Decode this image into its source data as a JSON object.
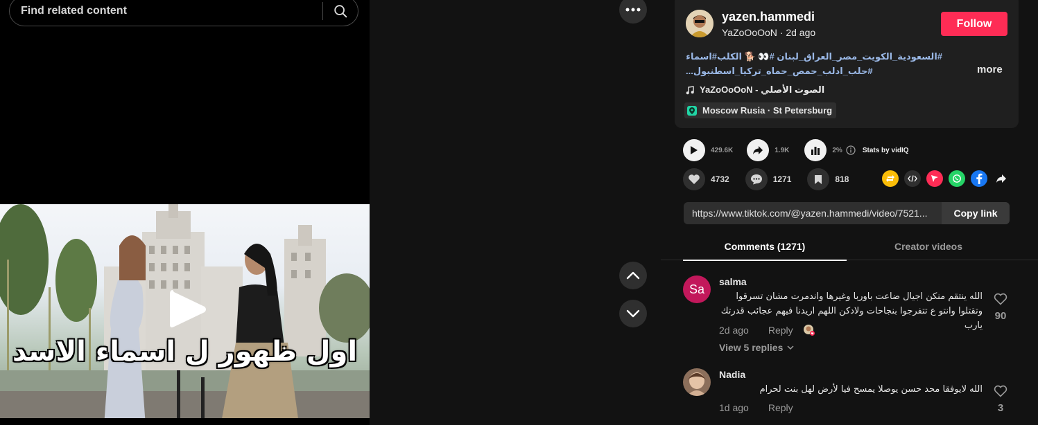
{
  "search": {
    "placeholder": "Find related content"
  },
  "video": {
    "overlay_text": "اول ظهور ل اسماء الاسد"
  },
  "post": {
    "username": "yazen.hammedi",
    "nickname": "YaZoOoOoN",
    "separator": " · ",
    "posted": "2d ago",
    "follow_label": "Follow",
    "desc_line1": "#السعودية_الكويت_مصر_العراق_لبنان #👀 🐕 الكلب#اسماء#",
    "desc_line2": "#حلب_ادلب_حمص_حماه_تركيا_اسطنبول...",
    "more_label": "more",
    "music": "الصوت الأصلي - YaZoOoOoN",
    "location": "Moscow Rusia · St Petersburg"
  },
  "stats": {
    "plays": "429.6K",
    "shares": "1.9K",
    "engagement": "2%",
    "stats_by": "Stats by vidIQ"
  },
  "actions": {
    "likes": "4732",
    "comments": "1271",
    "saves": "818"
  },
  "link": {
    "url": "https://www.tiktok.com/@yazen.hammedi/video/7521...",
    "copy_label": "Copy link"
  },
  "tabs": {
    "comments": "Comments (1271)",
    "creator": "Creator videos"
  },
  "comments": [
    {
      "name": "salma",
      "initials": "Sa",
      "text": "الله ينتقم منكن اجيال ضاعت باوربا وغيرها واندمرت مشان تسرقوا وتقتلوا وانتو ع تتفرجوا بنجاحات ولادكن اللهم اريدنا فيهم عجائب قدرتك يارب",
      "time": "2d ago",
      "reply": "Reply",
      "likes": "90",
      "view_replies": "View 5 replies"
    },
    {
      "name": "Nadia",
      "text": "الله لايوفقا محد حسن يوصلا يمسح فيا لأرض لهل بنت لحرام",
      "time": "1d ago",
      "reply": "Reply",
      "likes": "3"
    }
  ],
  "colors": {
    "follow": "#fe2c55",
    "hashtag": "#9ab8e6",
    "location_pin": "#20d5a5",
    "repost": "#fbbd08",
    "send": "#fe2c55",
    "whatsapp": "#25d366",
    "facebook": "#1877f2"
  },
  "icons": [
    "search-icon",
    "more-icon",
    "play-icon",
    "chevron-up-icon",
    "chevron-down-icon",
    "music-note-icon",
    "location-pin-icon",
    "share-arrow-icon",
    "bar-chart-icon",
    "info-icon",
    "heart-icon",
    "comment-icon",
    "bookmark-icon",
    "repost-icon",
    "embed-icon",
    "send-icon",
    "whatsapp-icon",
    "facebook-icon"
  ]
}
